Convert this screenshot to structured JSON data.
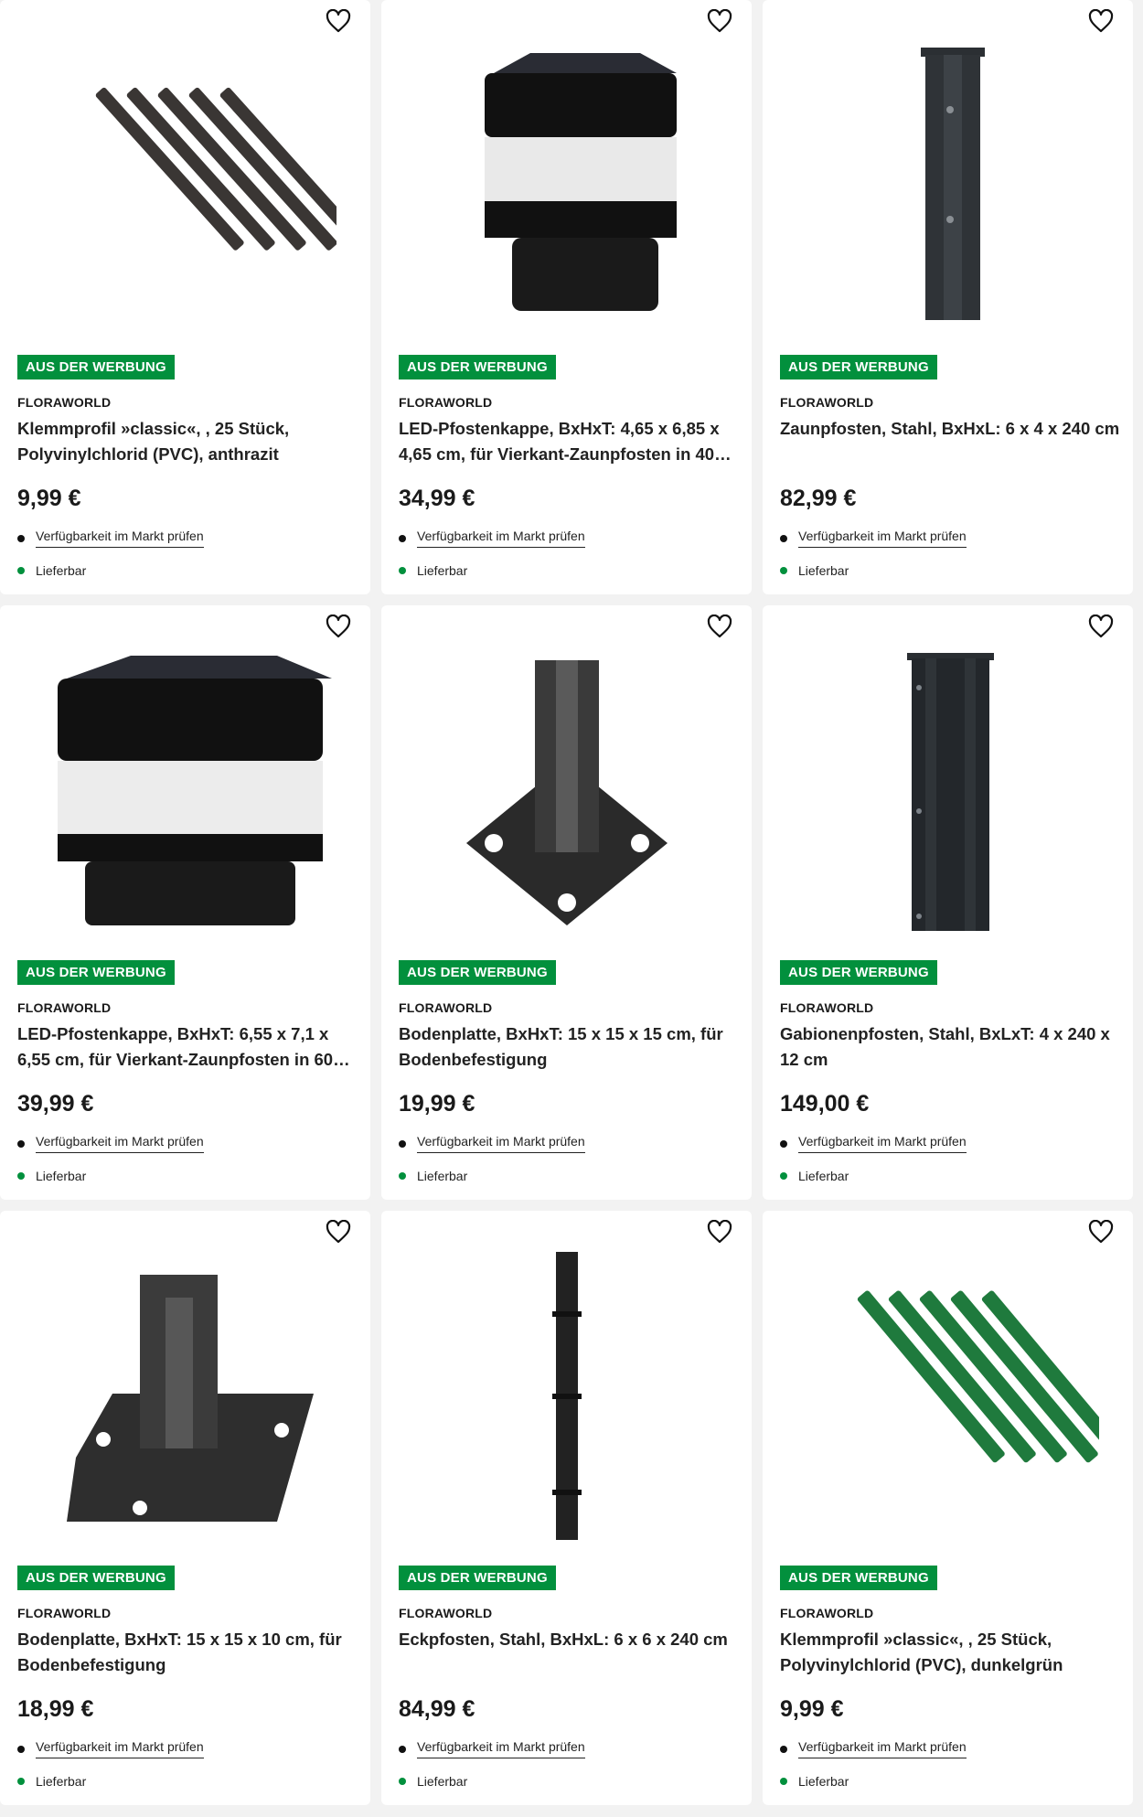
{
  "colors": {
    "badge": "#02903d",
    "in_stock_dot": "#02903d"
  },
  "icons": {
    "favorite": "heart-outline-icon"
  },
  "products": [
    {
      "badge": "AUS DER WERBUNG",
      "brand": "FLORAWORLD",
      "title": "Klemmprofil »classic«, , 25 Stück, Polyvinylchlorid (PVC), anthrazit",
      "price": "9,99 €",
      "availability_link": "Verfügbarkeit im Markt prüfen",
      "delivery": "Lieferbar"
    },
    {
      "badge": "AUS DER WERBUNG",
      "brand": "FLORAWORLD",
      "title": "LED-Pfostenkappe, BxHxT: 4,65 x 6,85 x 4,65 cm, für Vierkant-Zaunpfosten in 40…",
      "price": "34,99 €",
      "availability_link": "Verfügbarkeit im Markt prüfen",
      "delivery": "Lieferbar"
    },
    {
      "badge": "AUS DER WERBUNG",
      "brand": "FLORAWORLD",
      "title": "Zaunpfosten, Stahl, BxHxL: 6 x 4 x 240 cm",
      "price": "82,99 €",
      "availability_link": "Verfügbarkeit im Markt prüfen",
      "delivery": "Lieferbar"
    },
    {
      "badge": "AUS DER WERBUNG",
      "brand": "FLORAWORLD",
      "title": "LED-Pfostenkappe, BxHxT: 6,55 x 7,1 x 6,55 cm, für Vierkant-Zaunpfosten in 60…",
      "price": "39,99 €",
      "availability_link": "Verfügbarkeit im Markt prüfen",
      "delivery": "Lieferbar"
    },
    {
      "badge": "AUS DER WERBUNG",
      "brand": "FLORAWORLD",
      "title": "Bodenplatte, BxHxT: 15 x 15 x 15 cm, für Bodenbefestigung",
      "price": "19,99 €",
      "availability_link": "Verfügbarkeit im Markt prüfen",
      "delivery": "Lieferbar"
    },
    {
      "badge": "AUS DER WERBUNG",
      "brand": "FLORAWORLD",
      "title": "Gabionenpfosten, Stahl, BxLxT: 4 x 240 x 12 cm",
      "price": "149,00 €",
      "availability_link": "Verfügbarkeit im Markt prüfen",
      "delivery": "Lieferbar"
    },
    {
      "badge": "AUS DER WERBUNG",
      "brand": "FLORAWORLD",
      "title": "Bodenplatte, BxHxT: 15 x 15 x 10 cm, für Bodenbefestigung",
      "price": "18,99 €",
      "availability_link": "Verfügbarkeit im Markt prüfen",
      "delivery": "Lieferbar"
    },
    {
      "badge": "AUS DER WERBUNG",
      "brand": "FLORAWORLD",
      "title": "Eckpfosten, Stahl, BxHxL: 6 x 6 x 240 cm",
      "price": "84,99 €",
      "availability_link": "Verfügbarkeit im Markt prüfen",
      "delivery": "Lieferbar"
    },
    {
      "badge": "AUS DER WERBUNG",
      "brand": "FLORAWORLD",
      "title": "Klemmprofil »classic«, , 25 Stück, Polyvinylchlorid (PVC), dunkelgrün",
      "price": "9,99 €",
      "availability_link": "Verfügbarkeit im Markt prüfen",
      "delivery": "Lieferbar"
    }
  ]
}
